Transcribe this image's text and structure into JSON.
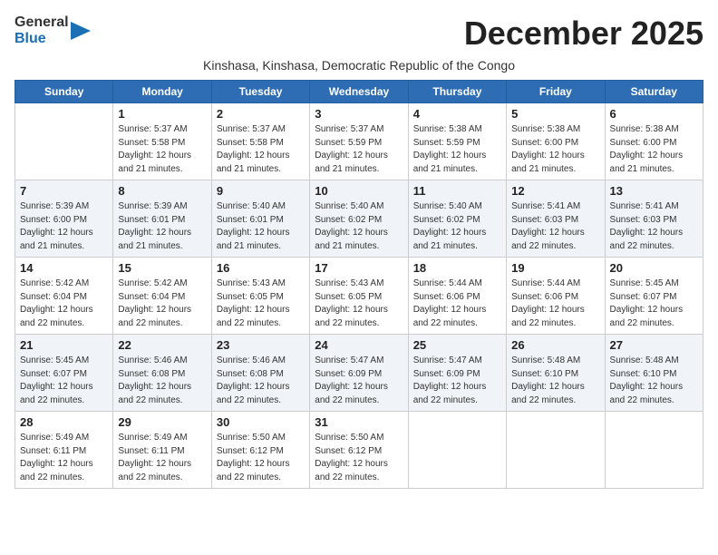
{
  "header": {
    "logo_general": "General",
    "logo_blue": "Blue",
    "month_title": "December 2025",
    "subtitle": "Kinshasa, Kinshasa, Democratic Republic of the Congo"
  },
  "days_of_week": [
    "Sunday",
    "Monday",
    "Tuesday",
    "Wednesday",
    "Thursday",
    "Friday",
    "Saturday"
  ],
  "weeks": [
    [
      {
        "day": "",
        "sunrise": "",
        "sunset": "",
        "daylight": ""
      },
      {
        "day": "1",
        "sunrise": "Sunrise: 5:37 AM",
        "sunset": "Sunset: 5:58 PM",
        "daylight": "Daylight: 12 hours and 21 minutes."
      },
      {
        "day": "2",
        "sunrise": "Sunrise: 5:37 AM",
        "sunset": "Sunset: 5:58 PM",
        "daylight": "Daylight: 12 hours and 21 minutes."
      },
      {
        "day": "3",
        "sunrise": "Sunrise: 5:37 AM",
        "sunset": "Sunset: 5:59 PM",
        "daylight": "Daylight: 12 hours and 21 minutes."
      },
      {
        "day": "4",
        "sunrise": "Sunrise: 5:38 AM",
        "sunset": "Sunset: 5:59 PM",
        "daylight": "Daylight: 12 hours and 21 minutes."
      },
      {
        "day": "5",
        "sunrise": "Sunrise: 5:38 AM",
        "sunset": "Sunset: 6:00 PM",
        "daylight": "Daylight: 12 hours and 21 minutes."
      },
      {
        "day": "6",
        "sunrise": "Sunrise: 5:38 AM",
        "sunset": "Sunset: 6:00 PM",
        "daylight": "Daylight: 12 hours and 21 minutes."
      }
    ],
    [
      {
        "day": "7",
        "sunrise": "Sunrise: 5:39 AM",
        "sunset": "Sunset: 6:00 PM",
        "daylight": "Daylight: 12 hours and 21 minutes."
      },
      {
        "day": "8",
        "sunrise": "Sunrise: 5:39 AM",
        "sunset": "Sunset: 6:01 PM",
        "daylight": "Daylight: 12 hours and 21 minutes."
      },
      {
        "day": "9",
        "sunrise": "Sunrise: 5:40 AM",
        "sunset": "Sunset: 6:01 PM",
        "daylight": "Daylight: 12 hours and 21 minutes."
      },
      {
        "day": "10",
        "sunrise": "Sunrise: 5:40 AM",
        "sunset": "Sunset: 6:02 PM",
        "daylight": "Daylight: 12 hours and 21 minutes."
      },
      {
        "day": "11",
        "sunrise": "Sunrise: 5:40 AM",
        "sunset": "Sunset: 6:02 PM",
        "daylight": "Daylight: 12 hours and 21 minutes."
      },
      {
        "day": "12",
        "sunrise": "Sunrise: 5:41 AM",
        "sunset": "Sunset: 6:03 PM",
        "daylight": "Daylight: 12 hours and 22 minutes."
      },
      {
        "day": "13",
        "sunrise": "Sunrise: 5:41 AM",
        "sunset": "Sunset: 6:03 PM",
        "daylight": "Daylight: 12 hours and 22 minutes."
      }
    ],
    [
      {
        "day": "14",
        "sunrise": "Sunrise: 5:42 AM",
        "sunset": "Sunset: 6:04 PM",
        "daylight": "Daylight: 12 hours and 22 minutes."
      },
      {
        "day": "15",
        "sunrise": "Sunrise: 5:42 AM",
        "sunset": "Sunset: 6:04 PM",
        "daylight": "Daylight: 12 hours and 22 minutes."
      },
      {
        "day": "16",
        "sunrise": "Sunrise: 5:43 AM",
        "sunset": "Sunset: 6:05 PM",
        "daylight": "Daylight: 12 hours and 22 minutes."
      },
      {
        "day": "17",
        "sunrise": "Sunrise: 5:43 AM",
        "sunset": "Sunset: 6:05 PM",
        "daylight": "Daylight: 12 hours and 22 minutes."
      },
      {
        "day": "18",
        "sunrise": "Sunrise: 5:44 AM",
        "sunset": "Sunset: 6:06 PM",
        "daylight": "Daylight: 12 hours and 22 minutes."
      },
      {
        "day": "19",
        "sunrise": "Sunrise: 5:44 AM",
        "sunset": "Sunset: 6:06 PM",
        "daylight": "Daylight: 12 hours and 22 minutes."
      },
      {
        "day": "20",
        "sunrise": "Sunrise: 5:45 AM",
        "sunset": "Sunset: 6:07 PM",
        "daylight": "Daylight: 12 hours and 22 minutes."
      }
    ],
    [
      {
        "day": "21",
        "sunrise": "Sunrise: 5:45 AM",
        "sunset": "Sunset: 6:07 PM",
        "daylight": "Daylight: 12 hours and 22 minutes."
      },
      {
        "day": "22",
        "sunrise": "Sunrise: 5:46 AM",
        "sunset": "Sunset: 6:08 PM",
        "daylight": "Daylight: 12 hours and 22 minutes."
      },
      {
        "day": "23",
        "sunrise": "Sunrise: 5:46 AM",
        "sunset": "Sunset: 6:08 PM",
        "daylight": "Daylight: 12 hours and 22 minutes."
      },
      {
        "day": "24",
        "sunrise": "Sunrise: 5:47 AM",
        "sunset": "Sunset: 6:09 PM",
        "daylight": "Daylight: 12 hours and 22 minutes."
      },
      {
        "day": "25",
        "sunrise": "Sunrise: 5:47 AM",
        "sunset": "Sunset: 6:09 PM",
        "daylight": "Daylight: 12 hours and 22 minutes."
      },
      {
        "day": "26",
        "sunrise": "Sunrise: 5:48 AM",
        "sunset": "Sunset: 6:10 PM",
        "daylight": "Daylight: 12 hours and 22 minutes."
      },
      {
        "day": "27",
        "sunrise": "Sunrise: 5:48 AM",
        "sunset": "Sunset: 6:10 PM",
        "daylight": "Daylight: 12 hours and 22 minutes."
      }
    ],
    [
      {
        "day": "28",
        "sunrise": "Sunrise: 5:49 AM",
        "sunset": "Sunset: 6:11 PM",
        "daylight": "Daylight: 12 hours and 22 minutes."
      },
      {
        "day": "29",
        "sunrise": "Sunrise: 5:49 AM",
        "sunset": "Sunset: 6:11 PM",
        "daylight": "Daylight: 12 hours and 22 minutes."
      },
      {
        "day": "30",
        "sunrise": "Sunrise: 5:50 AM",
        "sunset": "Sunset: 6:12 PM",
        "daylight": "Daylight: 12 hours and 22 minutes."
      },
      {
        "day": "31",
        "sunrise": "Sunrise: 5:50 AM",
        "sunset": "Sunset: 6:12 PM",
        "daylight": "Daylight: 12 hours and 22 minutes."
      },
      {
        "day": "",
        "sunrise": "",
        "sunset": "",
        "daylight": ""
      },
      {
        "day": "",
        "sunrise": "",
        "sunset": "",
        "daylight": ""
      },
      {
        "day": "",
        "sunrise": "",
        "sunset": "",
        "daylight": ""
      }
    ]
  ]
}
